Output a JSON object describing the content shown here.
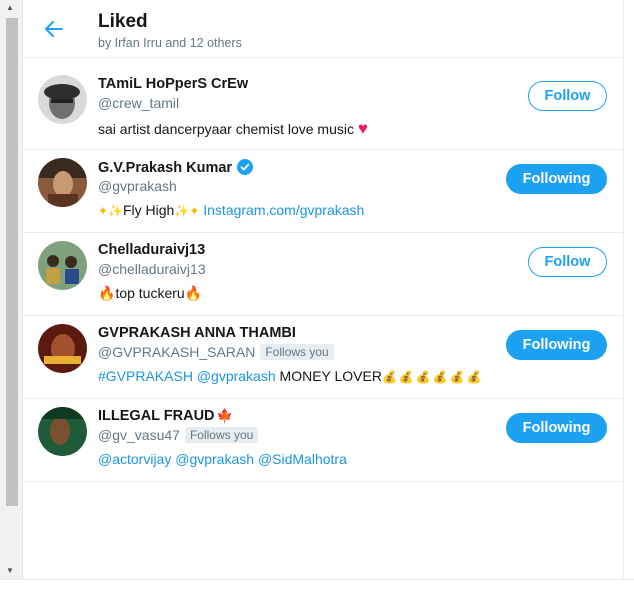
{
  "header": {
    "title": "Liked",
    "subtitle": "by Irfan Irru and 12 others"
  },
  "users": [
    {
      "name": "TAmiL HoPperS CrEw",
      "handle": "@crew_tamil",
      "bio_text": "sai artist dancerpyaar chemist love music",
      "button": "Follow"
    },
    {
      "name": "G.V.Prakash Kumar",
      "handle": "@gvprakash",
      "bio_text": "Fly High",
      "bio_link": "Instagram.com/gvprakash",
      "button": "Following"
    },
    {
      "name": "Chelladuraivj13",
      "handle": "@chelladuraivj13",
      "bio_text": "top tuckeru",
      "button": "Follow"
    },
    {
      "name": "GVPRAKASH ANNA THAMBI",
      "handle": "@GVPRAKASH_SARAN",
      "badge": "Follows you",
      "bio_hashtag": "#GVPRAKASH",
      "bio_mention": "@gvprakash",
      "bio_text": "MONEY LOVER",
      "button": "Following"
    },
    {
      "name": "ILLEGAL FRAUD",
      "handle": "@gv_vasu47",
      "badge": "Follows you",
      "bio_mentions": [
        "@actorvijay",
        "@gvprakash",
        "@SidMalhotra"
      ],
      "button": "Following"
    }
  ],
  "colors": {
    "accent": "#1da1f2",
    "link": "#1b95e0",
    "muted": "#657786",
    "border": "#e6ecf0"
  },
  "icons": {
    "back": "arrow-left-icon",
    "verified": "verified-badge-icon",
    "heart": "heart-icon",
    "money": "money-bag-icon",
    "fire": "fire-icon",
    "sparkle": "sparkles-icon",
    "flag": "maple-leaf-icon"
  }
}
